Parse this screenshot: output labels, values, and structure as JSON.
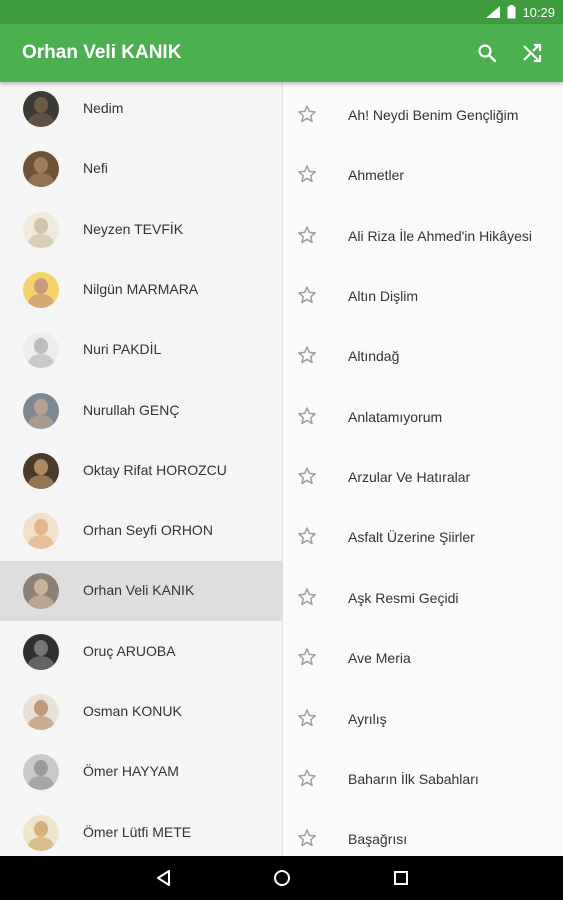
{
  "status_bar": {
    "time": "10:29",
    "signal": "4G"
  },
  "app_bar": {
    "title": "Orhan Veli KANIK",
    "actions": [
      "search-icon",
      "shuffle-icon"
    ]
  },
  "poets": [
    {
      "name": "Nedim",
      "skin": "#6b5a48",
      "bg": "#3d3a35"
    },
    {
      "name": "Nefi",
      "skin": "#a07c5a",
      "bg": "#6e5338"
    },
    {
      "name": "Neyzen TEVFİK",
      "skin": "#d2c4a8",
      "bg": "#f0eadc"
    },
    {
      "name": "Nilgün MARMARA",
      "skin": "#c99b7a",
      "bg": "#f3d36a"
    },
    {
      "name": "Nuri PAKDİL",
      "skin": "#bdbdbd",
      "bg": "#ececec"
    },
    {
      "name": "Nurullah GENÇ",
      "skin": "#b7a090",
      "bg": "#7d8894"
    },
    {
      "name": "Oktay Rifat HOROZCU",
      "skin": "#b08a62",
      "bg": "#4a3a2c"
    },
    {
      "name": "Orhan Seyfi ORHON",
      "skin": "#e3b58c",
      "bg": "#f2e0c8"
    },
    {
      "name": "Orhan Veli KANIK",
      "skin": "#c8b29a",
      "bg": "#8d8074"
    },
    {
      "name": "Oruç ARUOBA",
      "skin": "#777777",
      "bg": "#2f2f2f"
    },
    {
      "name": "Osman KONUK",
      "skin": "#c09a78",
      "bg": "#e9e1d6"
    },
    {
      "name": "Ömer HAYYAM",
      "skin": "#9a9a9a",
      "bg": "#c9c9c9"
    },
    {
      "name": "Ömer Lütfi METE",
      "skin": "#d5b078",
      "bg": "#efe4cc"
    }
  ],
  "selected_poet": "Orhan Veli KANIK",
  "poems": [
    "Ah! Neydi Benim Gençliğim",
    "Ahmetler",
    "Ali Riza İle Ahmed'in Hikâyesi",
    "Altın Dişlim",
    "Altındağ",
    "Anlatamıyorum",
    "Arzular Ve Hatıralar",
    "Asfalt Üzerine Şiirler",
    "Aşk Resmi Geçidi",
    "Ave Meria",
    "Ayrılış",
    "Baharın İlk Sabahları",
    "Başağrısı"
  ],
  "colors": {
    "primary": "#4caf50",
    "primary_dark": "#3e9c3f",
    "star": "#9e9e9e"
  },
  "nav_bar": [
    "back-icon",
    "home-icon",
    "recents-icon"
  ]
}
